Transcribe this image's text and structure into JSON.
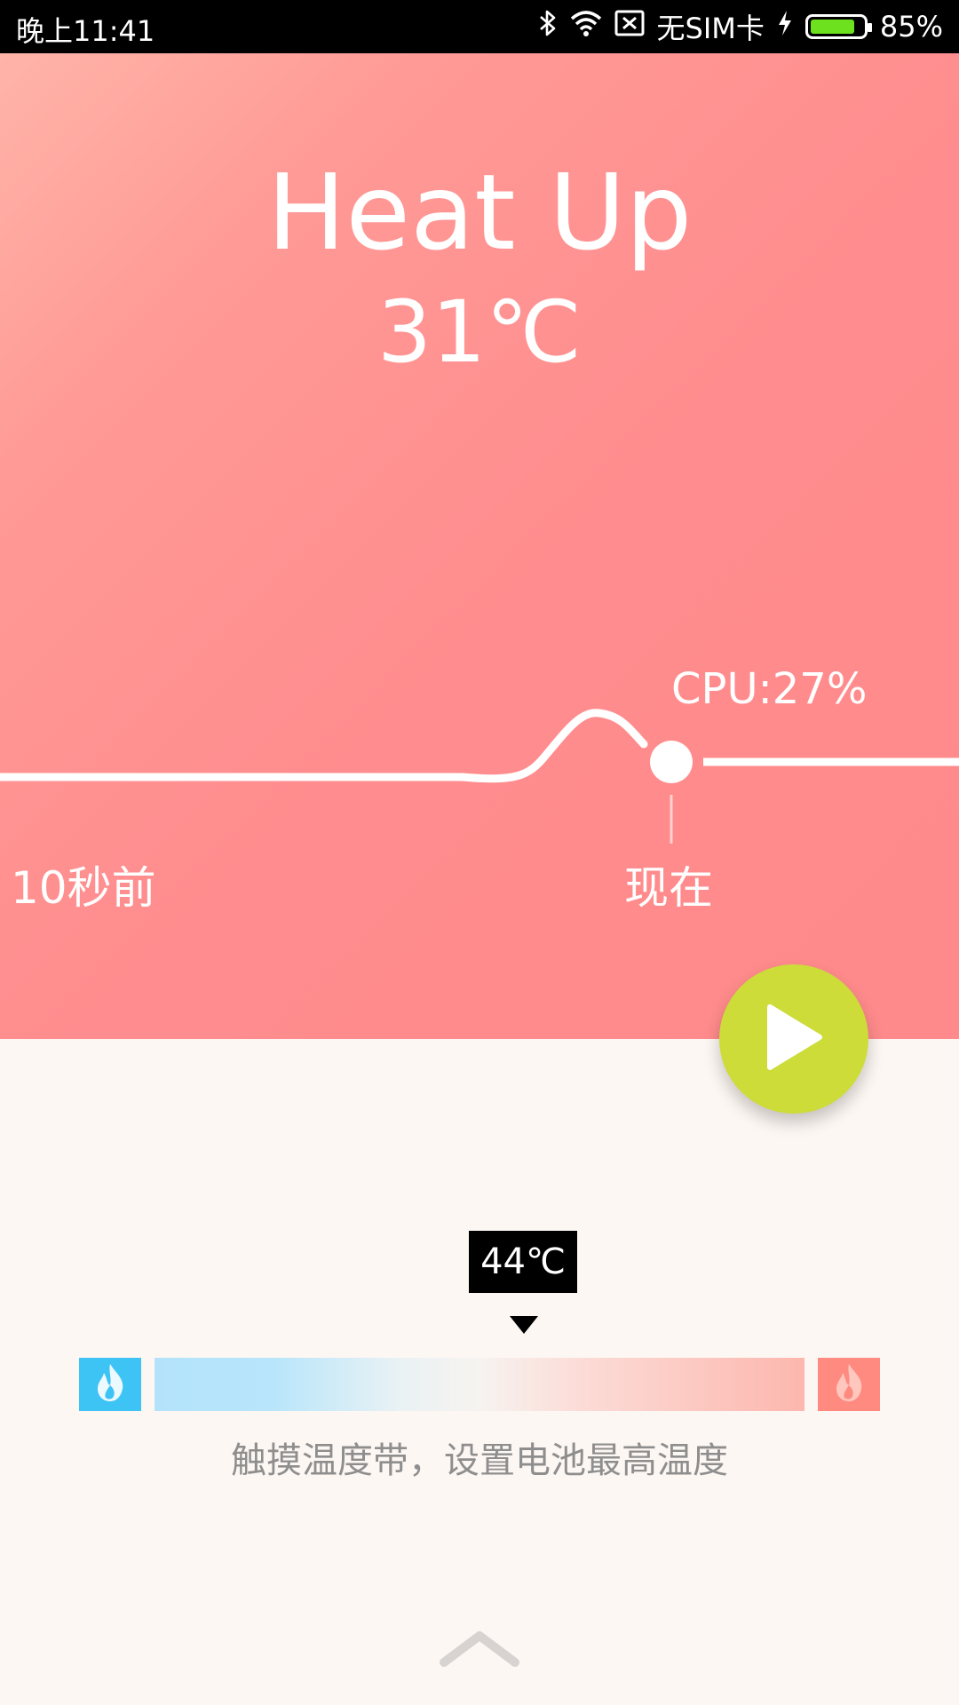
{
  "status_bar": {
    "time": "晚上11:41",
    "carrier": "无SIM卡",
    "battery_percent": "85%",
    "battery_level": 0.85,
    "icons": [
      "bluetooth-icon",
      "wifi-icon",
      "no-sim-icon",
      "charging-icon",
      "battery-icon"
    ]
  },
  "hero": {
    "title": "Heat Up",
    "temperature": "31℃",
    "cpu_label": "CPU:27%",
    "time_start_label": "10秒前",
    "time_now_label": "现在"
  },
  "fab": {
    "icon": "play-icon",
    "color": "#cddc39"
  },
  "band": {
    "selected_temp": "44℃",
    "hint": "触摸温度带，设置电池最高温度",
    "cold_icon": "flame-icon",
    "hot_icon": "flame-icon",
    "cold_color": "#3ec3f5",
    "hot_color": "#ff8a80"
  },
  "footer": {
    "icon": "chevron-up-icon"
  }
}
